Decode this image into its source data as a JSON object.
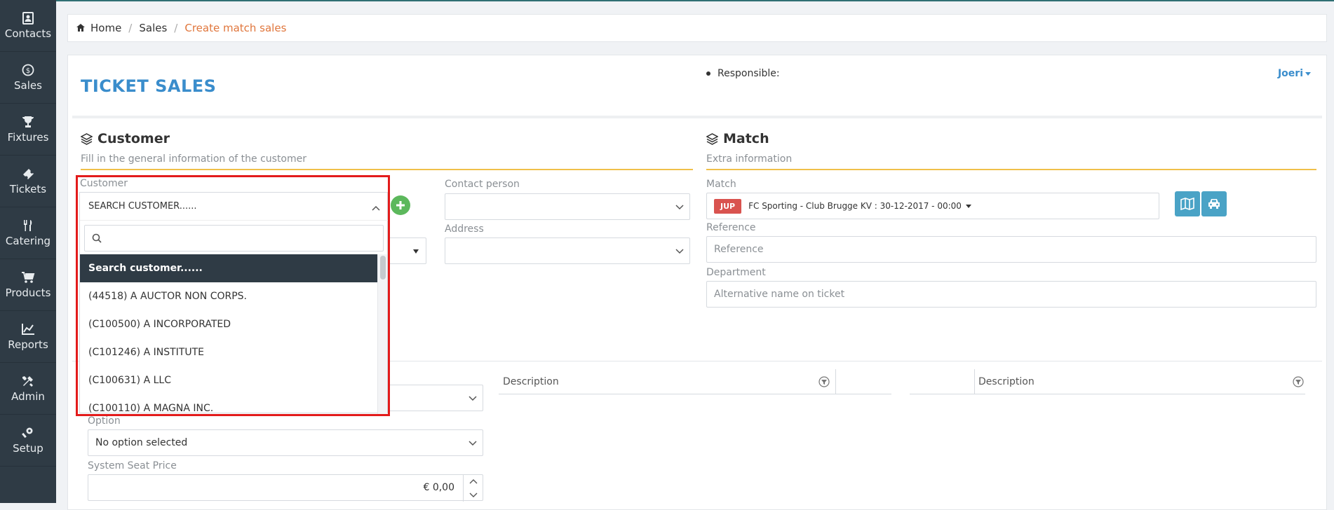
{
  "sidebar": {
    "items": [
      {
        "label": "Contacts",
        "icon": "contacts-icon"
      },
      {
        "label": "Sales",
        "icon": "dollar-icon"
      },
      {
        "label": "Fixtures",
        "icon": "trophy-icon"
      },
      {
        "label": "Tickets",
        "icon": "ticket-icon"
      },
      {
        "label": "Catering",
        "icon": "cutlery-icon"
      },
      {
        "label": "Products",
        "icon": "cart-icon"
      },
      {
        "label": "Reports",
        "icon": "chart-icon"
      },
      {
        "label": "Admin",
        "icon": "tools-icon"
      },
      {
        "label": "Setup",
        "icon": "gear-icon"
      }
    ]
  },
  "breadcrumb": {
    "home": "Home",
    "sales": "Sales",
    "current": "Create match sales"
  },
  "page": {
    "title": "TICKET SALES",
    "responsible_label": "Responsible:",
    "user": "Joeri"
  },
  "customer": {
    "heading": "Customer",
    "subtitle": "Fill in the general information of the customer",
    "customer_label": "Customer",
    "contact_label": "Contact person",
    "address_label": "Address"
  },
  "match": {
    "heading": "Match",
    "subtitle": "Extra information",
    "match_label": "Match",
    "badge": "JUP",
    "selected": "FC Sporting - Club Brugge KV : 30-12-2017 - 00:00",
    "reference_label": "Reference",
    "reference_placeholder": "Reference",
    "department_label": "Department",
    "department_placeholder": "Alternative name on ticket"
  },
  "lower": {
    "option_label": "Option",
    "option_value": "No option selected",
    "price_label": "System Seat Price",
    "price_value": "€ 0,00",
    "desc_col_1": "Description",
    "desc_col_2": "Description"
  },
  "dropdown": {
    "trigger": "SEARCH CUSTOMER......",
    "search_value": "",
    "options": [
      "Search customer......",
      "(44518) A AUCTOR NON CORPS.",
      "(C100500) A INCORPORATED",
      "(C101246) A INSTITUTE",
      "(C100631) A LLC",
      "(C100110) A MAGNA INC."
    ]
  },
  "colors": {
    "accent": "#3a8dcc",
    "sidebar": "#2f3b45",
    "highlight": "#e31b1b",
    "section_line": "#f0c04a",
    "badge": "#d9534f"
  }
}
